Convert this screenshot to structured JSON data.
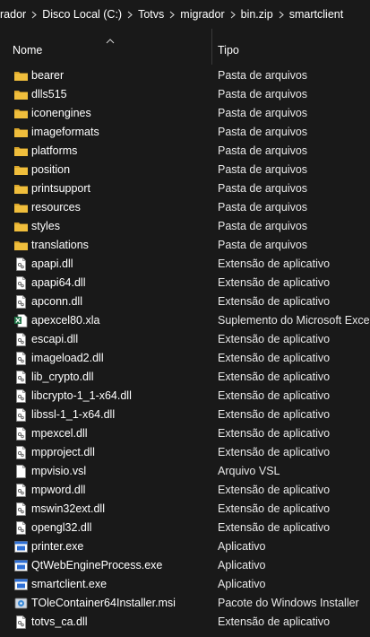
{
  "breadcrumb": [
    "rador",
    "Disco Local (C:)",
    "Totvs",
    "migrador",
    "bin.zip",
    "smartclient"
  ],
  "header": {
    "name_label": "Nome",
    "type_label": "Tipo"
  },
  "files": [
    {
      "name": "bearer",
      "type": "Pasta de arquivos",
      "icon": "folder-icon"
    },
    {
      "name": "dlls515",
      "type": "Pasta de arquivos",
      "icon": "folder-icon"
    },
    {
      "name": "iconengines",
      "type": "Pasta de arquivos",
      "icon": "folder-icon"
    },
    {
      "name": "imageformats",
      "type": "Pasta de arquivos",
      "icon": "folder-icon"
    },
    {
      "name": "platforms",
      "type": "Pasta de arquivos",
      "icon": "folder-icon"
    },
    {
      "name": "position",
      "type": "Pasta de arquivos",
      "icon": "folder-icon"
    },
    {
      "name": "printsupport",
      "type": "Pasta de arquivos",
      "icon": "folder-icon"
    },
    {
      "name": "resources",
      "type": "Pasta de arquivos",
      "icon": "folder-icon"
    },
    {
      "name": "styles",
      "type": "Pasta de arquivos",
      "icon": "folder-icon"
    },
    {
      "name": "translations",
      "type": "Pasta de arquivos",
      "icon": "folder-icon"
    },
    {
      "name": "apapi.dll",
      "type": "Extensão de aplicativo",
      "icon": "dll-file-icon"
    },
    {
      "name": "apapi64.dll",
      "type": "Extensão de aplicativo",
      "icon": "dll-file-icon"
    },
    {
      "name": "apconn.dll",
      "type": "Extensão de aplicativo",
      "icon": "dll-file-icon"
    },
    {
      "name": "apexcel80.xla",
      "type": "Suplemento do Microsoft Excel",
      "icon": "excel-addin-icon"
    },
    {
      "name": "escapi.dll",
      "type": "Extensão de aplicativo",
      "icon": "dll-file-icon"
    },
    {
      "name": "imageload2.dll",
      "type": "Extensão de aplicativo",
      "icon": "dll-file-icon"
    },
    {
      "name": "lib_crypto.dll",
      "type": "Extensão de aplicativo",
      "icon": "dll-file-icon"
    },
    {
      "name": "libcrypto-1_1-x64.dll",
      "type": "Extensão de aplicativo",
      "icon": "dll-file-icon"
    },
    {
      "name": "libssl-1_1-x64.dll",
      "type": "Extensão de aplicativo",
      "icon": "dll-file-icon"
    },
    {
      "name": "mpexcel.dll",
      "type": "Extensão de aplicativo",
      "icon": "dll-file-icon"
    },
    {
      "name": "mpproject.dll",
      "type": "Extensão de aplicativo",
      "icon": "dll-file-icon"
    },
    {
      "name": "mpvisio.vsl",
      "type": "Arquivo VSL",
      "icon": "generic-file-icon"
    },
    {
      "name": "mpword.dll",
      "type": "Extensão de aplicativo",
      "icon": "dll-file-icon"
    },
    {
      "name": "mswin32ext.dll",
      "type": "Extensão de aplicativo",
      "icon": "dll-file-icon"
    },
    {
      "name": "opengl32.dll",
      "type": "Extensão de aplicativo",
      "icon": "dll-file-icon"
    },
    {
      "name": "printer.exe",
      "type": "Aplicativo",
      "icon": "exe-icon"
    },
    {
      "name": "QtWebEngineProcess.exe",
      "type": "Aplicativo",
      "icon": "exe-icon"
    },
    {
      "name": "smartclient.exe",
      "type": "Aplicativo",
      "icon": "exe-icon"
    },
    {
      "name": "TOleContainer64Installer.msi",
      "type": "Pacote do Windows Installer",
      "icon": "msi-installer-icon"
    },
    {
      "name": "totvs_ca.dll",
      "type": "Extensão de aplicativo",
      "icon": "dll-file-icon"
    }
  ],
  "colors": {
    "background": "#191919",
    "folder": "#F0BE3C",
    "excel_green": "#1E7145"
  }
}
